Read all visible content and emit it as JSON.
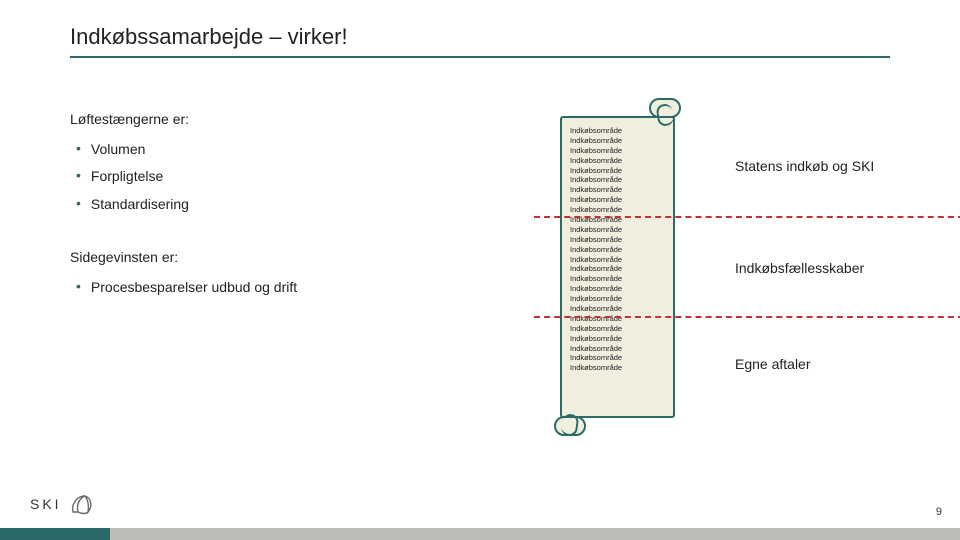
{
  "title": "Indkøbssamarbejde – virker!",
  "left": {
    "section1": {
      "heading": "Løftestængerne er:",
      "bullets": [
        "Volumen",
        "Forpligtelse",
        "Standardisering"
      ]
    },
    "section2": {
      "heading": "Sidegevinsten er:",
      "bullets": [
        "Procesbesparelser udbud og drift"
      ]
    }
  },
  "scroll": {
    "item_text": "Indkøbsområde",
    "count": 25
  },
  "right": {
    "labels": [
      "Statens indkøb og SKI",
      "Indkøbsfællesskaber",
      "Egne aftaler"
    ]
  },
  "footer": {
    "logo_text": "SKI",
    "page_number": "9"
  },
  "colors": {
    "accent": "#2b6a68",
    "dashed": "#c23030",
    "scroll_fill": "#f0efdf",
    "footer_bar": "#bcbcb9"
  }
}
